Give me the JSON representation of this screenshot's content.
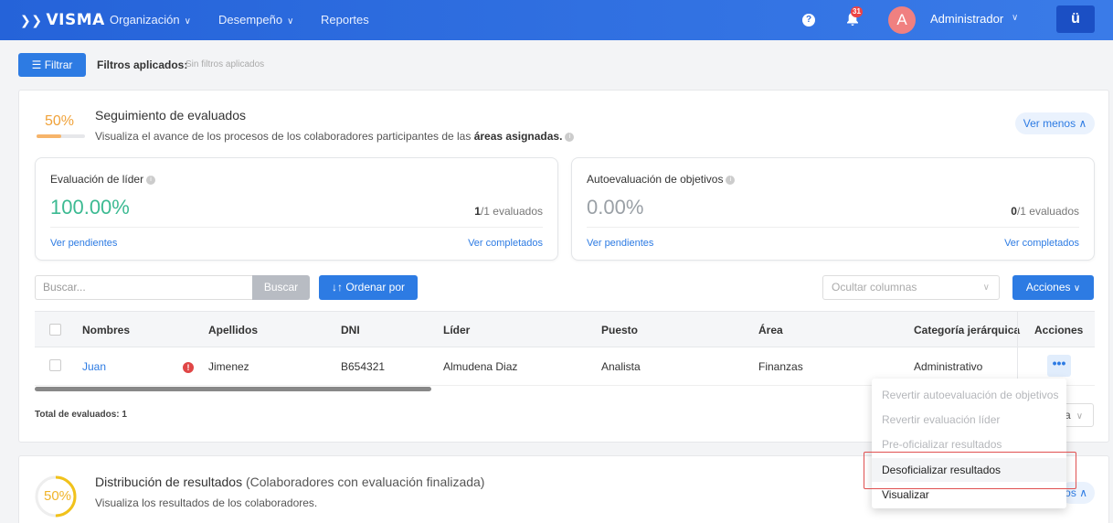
{
  "nav": {
    "logo": "VISMA",
    "items": [
      {
        "label": "Organización",
        "chevron": true
      },
      {
        "label": "Desempeño",
        "chevron": true
      },
      {
        "label": "Reportes",
        "chevron": false
      }
    ],
    "help_icon": "question-circle-icon",
    "notifications_count": "31",
    "avatar_initial": "A",
    "user_name": "Administrador",
    "app_button_label": "ü",
    "accent": "#2f6fdf"
  },
  "filters": {
    "button_label": "Filtrar",
    "label": "Filtros aplicados:",
    "value": "Sin filtros aplicados"
  },
  "tracking": {
    "percent": "50%",
    "progress": 0.5,
    "title": "Seguimiento de evaluados",
    "subtitle_pre": "Visualiza el avance de los procesos de los colaboradores participantes de las",
    "subtitle_bold": "áreas asignadas.",
    "toggle_label": "Ver menos"
  },
  "cards": [
    {
      "title": "Evaluación de líder",
      "percent": "100.00%",
      "percent_color": "#3cba92",
      "count_done": "1",
      "count_total": "/1 evaluados",
      "link_pending": "Ver pendientes",
      "link_done": "Ver completados"
    },
    {
      "title": "Autoevaluación de objetivos",
      "percent": "0.00%",
      "percent_color": "#9aa0a6",
      "count_done": "0",
      "count_total": "/1 evaluados",
      "link_pending": "Ver pendientes",
      "link_done": "Ver completados"
    }
  ],
  "toolbar": {
    "search_placeholder": "Buscar...",
    "search_button": "Buscar",
    "order_button": "Ordenar por",
    "hide_columns": "Ocultar columnas",
    "actions_button": "Acciones"
  },
  "table": {
    "headers": [
      "Nombres",
      "Apellidos",
      "DNI",
      "Líder",
      "Puesto",
      "Área",
      "Categoría jerárquica",
      "Acciones"
    ],
    "rows": [
      {
        "nombres": "Juan",
        "apellidos": "Jimenez",
        "dni": "B654321",
        "lider": "Almudena Diaz",
        "puesto": "Analista",
        "area": "Finanzas",
        "categoria": "Administrativo"
      }
    ],
    "total_label": "Total de evaluados:",
    "total_value": "1",
    "pager_text": "a"
  },
  "distribution": {
    "percent": "50%",
    "progress": 0.5,
    "title": "Distribución de resultados",
    "title_suffix": "(Colaboradores con evaluación finalizada)",
    "subtitle": "Visualiza los resultados de los colaboradores.",
    "toggle_fragment": "os"
  },
  "row_menu": {
    "items": [
      {
        "label": "Revertir autoevaluación de objetivos",
        "enabled": false
      },
      {
        "label": "Revertir evaluación líder",
        "enabled": false
      },
      {
        "label": "Pre-oficializar resultados",
        "enabled": false
      },
      {
        "label": "Desoficializar resultados",
        "enabled": true
      },
      {
        "label": "Visualizar",
        "enabled": true
      }
    ]
  }
}
